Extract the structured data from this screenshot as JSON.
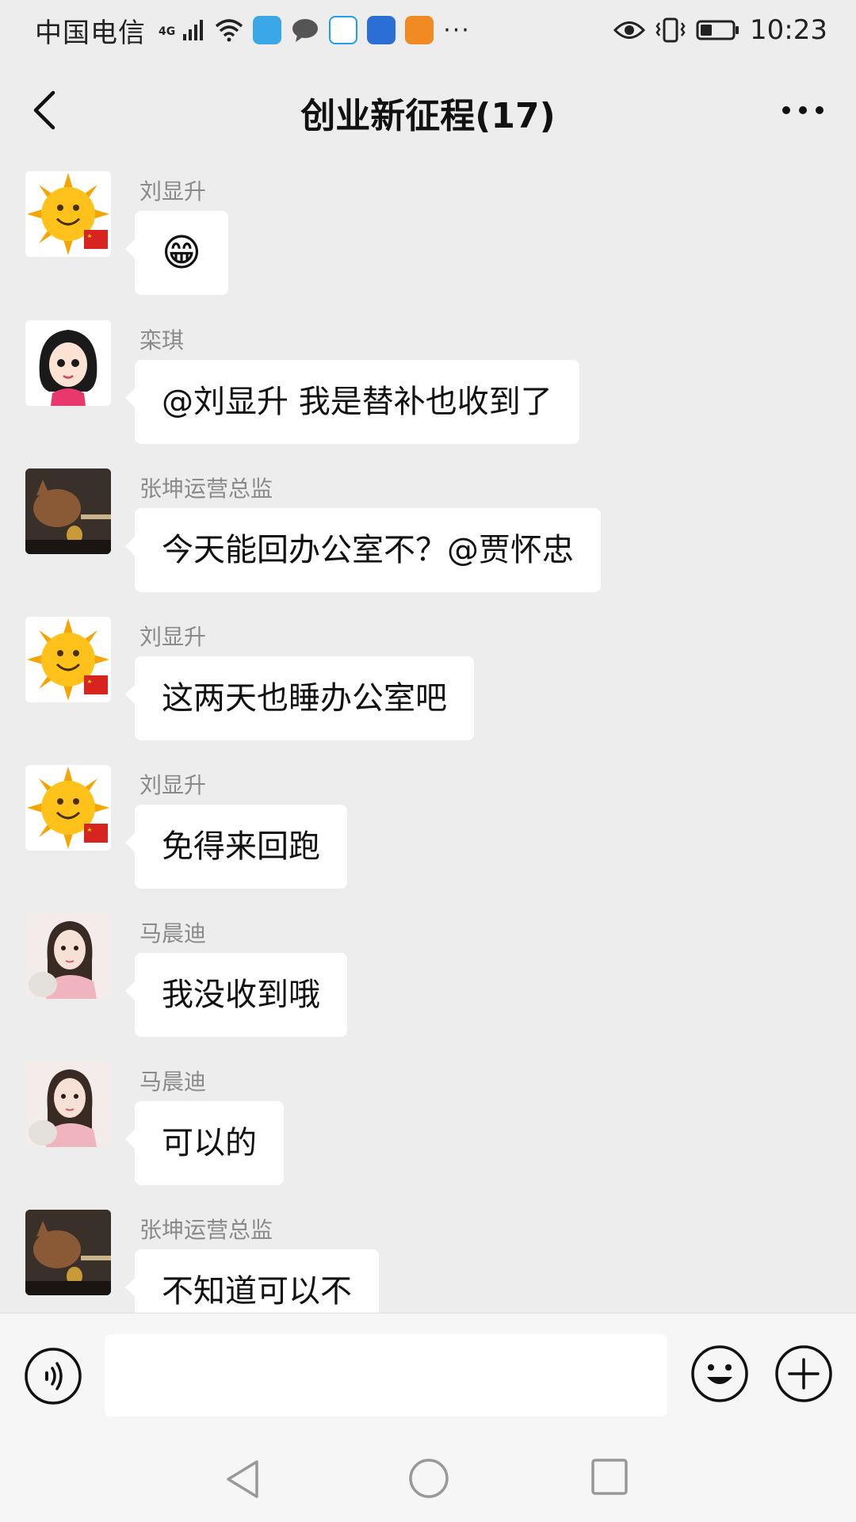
{
  "status_bar": {
    "carrier": "中国电信",
    "network": "4G",
    "time": "10:23",
    "overflow": "···",
    "app_icons": [
      {
        "name": "browser-app-icon",
        "color": "#3aa8e8"
      },
      {
        "name": "message-app-icon",
        "color": "#555555"
      },
      {
        "name": "qq-app-icon",
        "color": "#1ea0e8"
      },
      {
        "name": "sync-app-icon",
        "color": "#2b6fd6"
      },
      {
        "name": "key-app-icon",
        "color": "#f08a22"
      }
    ]
  },
  "header": {
    "title": "创业新征程(17)"
  },
  "messages": [
    {
      "sender": "刘显升",
      "text": "😁",
      "avatar": "sun-avatar"
    },
    {
      "sender": "栾琪",
      "text": "@刘显升  我是替补也收到了",
      "avatar": "cartoon-girl-avatar"
    },
    {
      "sender": "张坤运营总监",
      "text": "今天能回办公室不？@贾怀忠",
      "avatar": "cat-avatar"
    },
    {
      "sender": "刘显升",
      "text": "这两天也睡办公室吧",
      "avatar": "sun-avatar"
    },
    {
      "sender": "刘显升",
      "text": "免得来回跑",
      "avatar": "sun-avatar"
    },
    {
      "sender": "马晨迪",
      "text": "我没收到哦",
      "avatar": "illustrated-girl-avatar"
    },
    {
      "sender": "马晨迪",
      "text": "可以的",
      "avatar": "illustrated-girl-avatar"
    },
    {
      "sender": "张坤运营总监",
      "text": "不知道可以不",
      "avatar": "cat-avatar"
    }
  ],
  "input": {
    "value": "",
    "placeholder": ""
  },
  "colors": {
    "background": "#ededed",
    "bubble": "#ffffff",
    "sender_name": "#8a8a8a",
    "icon_stroke": "#111111"
  }
}
